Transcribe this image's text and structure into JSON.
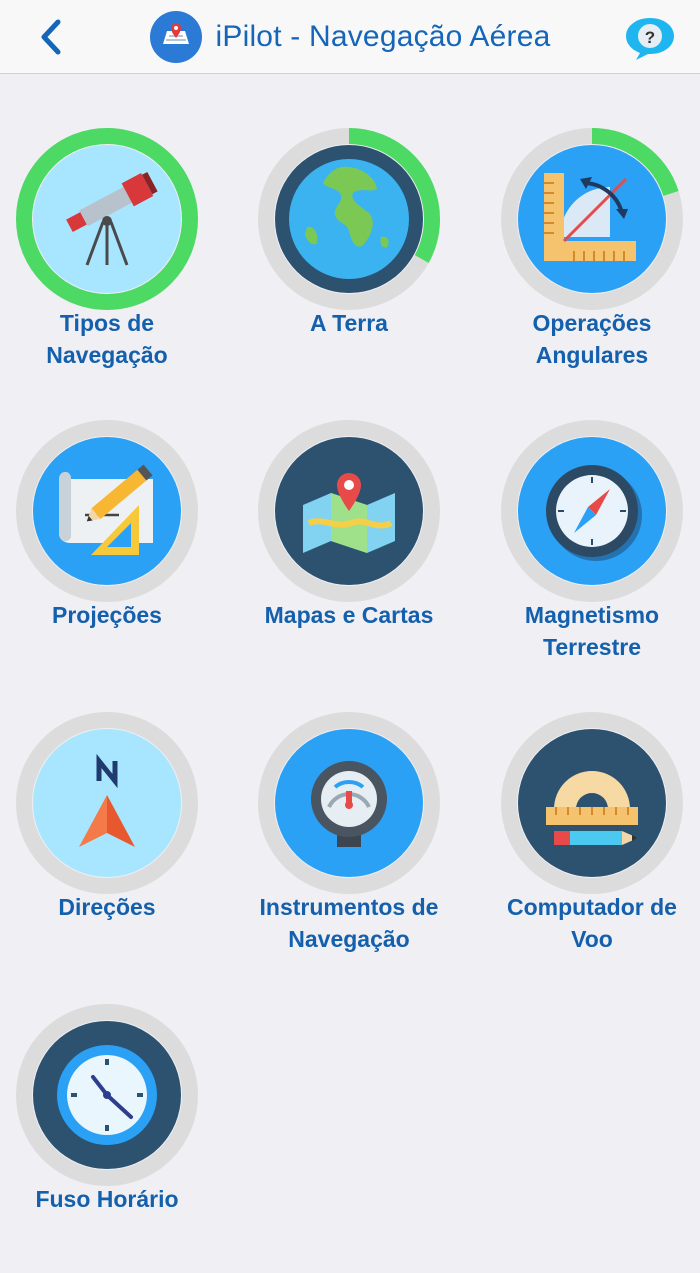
{
  "header": {
    "title": "iPilot - Navegação Aérea",
    "back_icon": "chevron-left-icon",
    "help_icon": "help-bubble-icon",
    "logo_icon": "map-pin-logo-icon"
  },
  "colors": {
    "accent": "#1565b8",
    "label": "#1460ad",
    "progress": "#4cd964",
    "ring_track": "#dcdcdc",
    "navy": "#2c5270",
    "light_blue": "#a8e6ff",
    "blue": "#2aa1f5"
  },
  "tiles": [
    {
      "label": "Tipos de\nNavegação",
      "icon": "telescope-icon",
      "progress": 1.0
    },
    {
      "label": "A Terra",
      "icon": "earth-globe-icon",
      "progress": 0.33
    },
    {
      "label": "Operações\nAngulares",
      "icon": "angle-ruler-icon",
      "progress": 0.2
    },
    {
      "label": "Projeções",
      "icon": "blueprint-pencil-icon",
      "progress": 0
    },
    {
      "label": "Mapas e Cartas",
      "icon": "folded-map-icon",
      "progress": 0
    },
    {
      "label": "Magnetismo\nTerrestre",
      "icon": "compass-icon",
      "progress": 0
    },
    {
      "label": "Direções",
      "icon": "north-arrow-icon",
      "progress": 0
    },
    {
      "label": "Instrumentos de\nNavegação",
      "icon": "gauge-instrument-icon",
      "progress": 0
    },
    {
      "label": "Computador de\nVoo",
      "icon": "protractor-pencil-icon",
      "progress": 0
    },
    {
      "label": "Fuso Horário",
      "icon": "clock-icon",
      "progress": 0
    }
  ]
}
